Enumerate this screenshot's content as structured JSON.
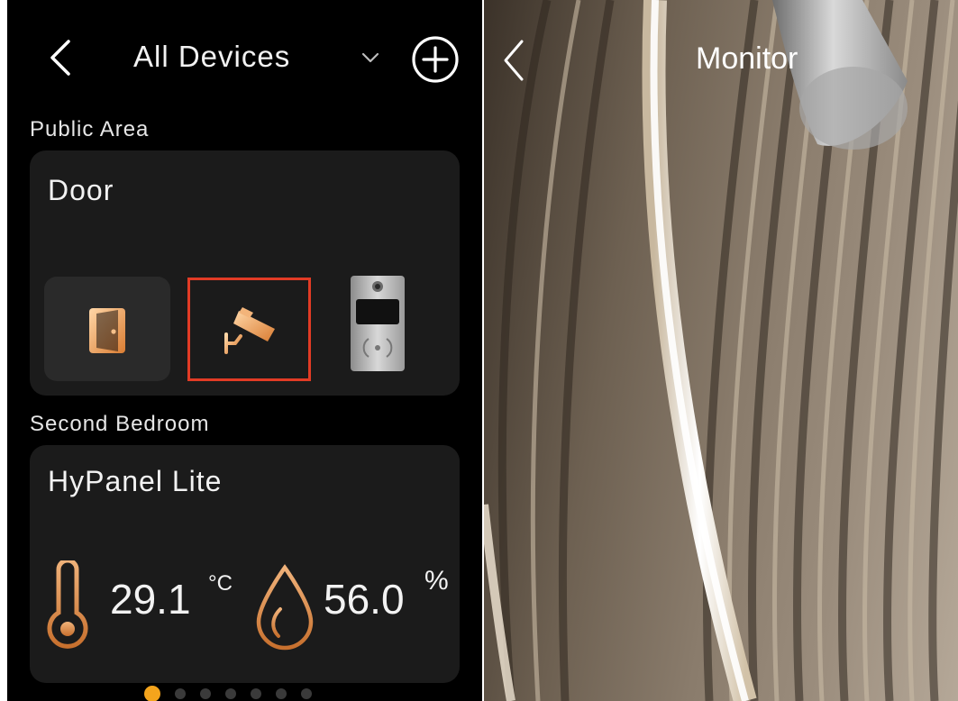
{
  "header": {
    "title": "All Devices"
  },
  "sections": [
    {
      "title": "Public Area",
      "card": {
        "title": "Door",
        "devices": [
          {
            "icon": "door-icon"
          },
          {
            "icon": "camera-icon",
            "selected": true
          },
          {
            "icon": "intercom-icon"
          }
        ]
      }
    },
    {
      "title": "Second Bedroom",
      "card": {
        "title": "HyPanel Lite",
        "temperature": {
          "value": "29.1",
          "unit": "°C"
        },
        "humidity": {
          "value": "56.0",
          "unit": "%"
        }
      }
    }
  ],
  "pagination": {
    "count": 7,
    "active": 0
  },
  "monitor": {
    "title": "Monitor"
  },
  "colors": {
    "accent": "#f4a41c",
    "selection": "#e23b25",
    "card": "#1b1b1b"
  }
}
